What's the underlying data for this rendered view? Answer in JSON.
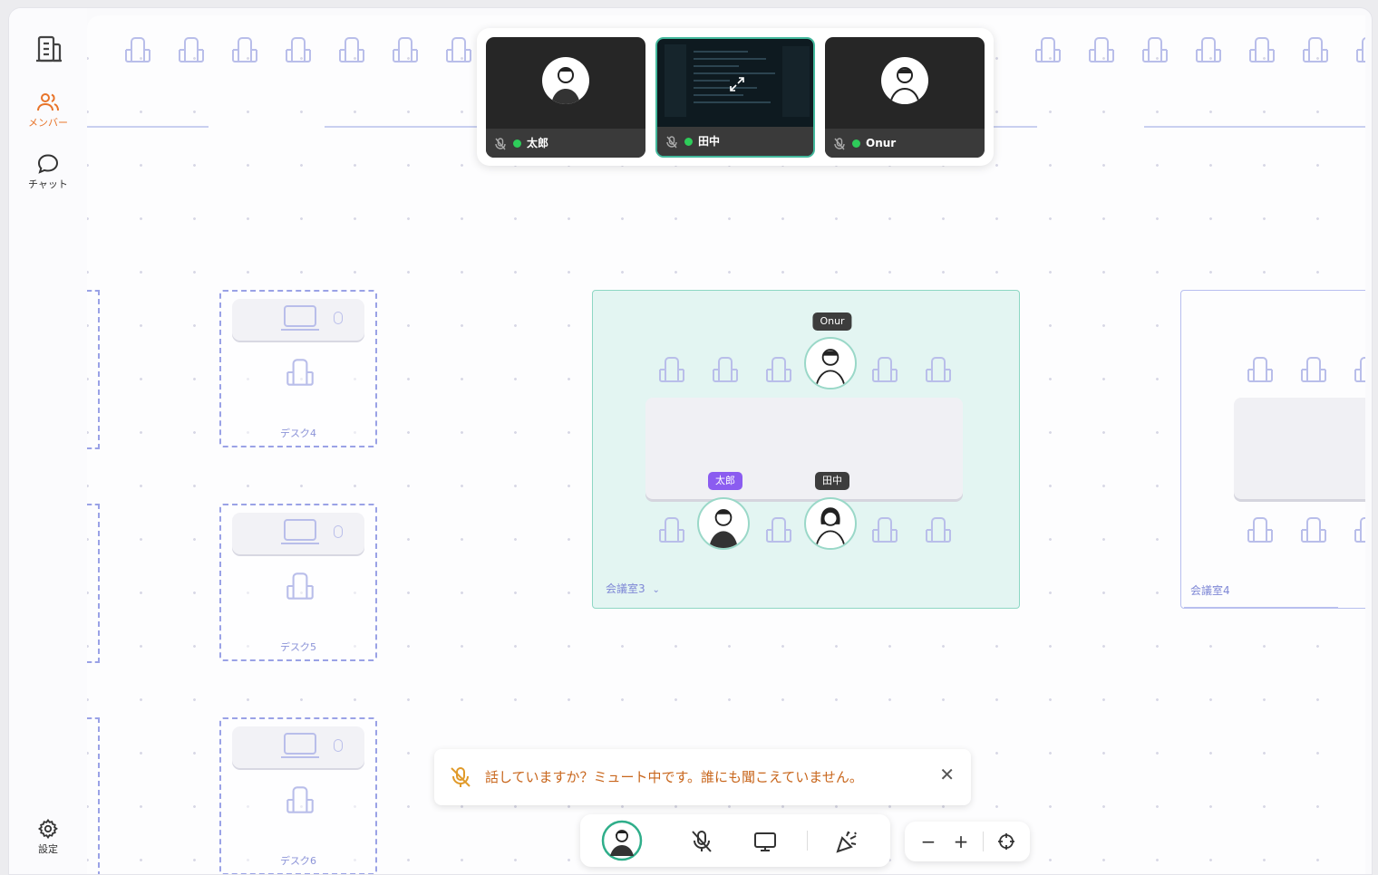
{
  "sidebar": {
    "members_label": "メンバー",
    "chat_label": "チャット",
    "settings_label": "設定",
    "accent": "#e8742a"
  },
  "video_tiles": [
    {
      "name": "太郎",
      "status": "online",
      "muted": true
    },
    {
      "name": "田中",
      "status": "online",
      "muted": true,
      "screen_share": true
    },
    {
      "name": "Onur",
      "status": "online",
      "muted": true
    }
  ],
  "desks": [
    {
      "label": "デスク4"
    },
    {
      "label": "デスク5"
    },
    {
      "label": "デスク6"
    }
  ],
  "rooms": {
    "room3": {
      "label": "会議室3",
      "tags": {
        "onur": "Onur",
        "taro": "太郎",
        "tanaka": "田中"
      }
    },
    "room4": {
      "label": "会議室4"
    }
  },
  "toast": {
    "message": "話していますか？ミュート中です。誰にも聞こえていません。",
    "close": "✕"
  },
  "zoom": {
    "minus": "−",
    "plus": "+"
  }
}
